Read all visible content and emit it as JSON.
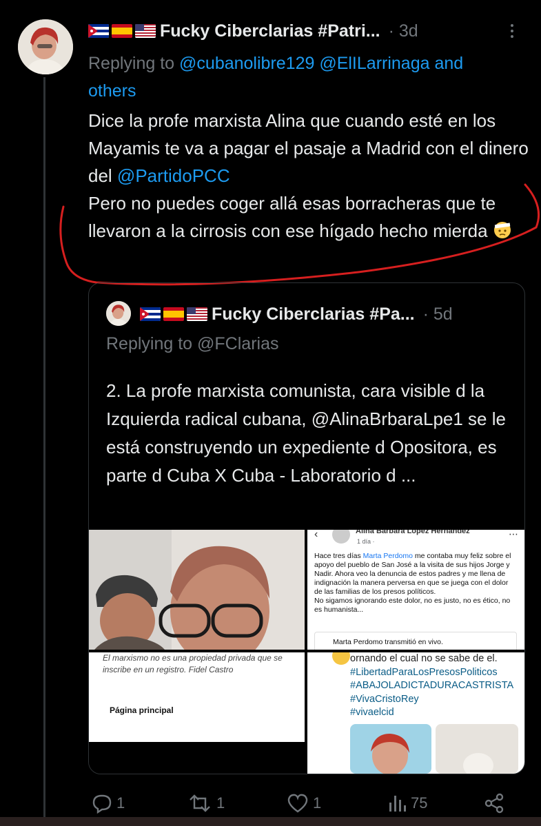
{
  "tweet": {
    "display_name": "Fucky Ciberclarias #Patri...",
    "time": "3d",
    "replying_prefix": "Replying to",
    "replying_mentions": "@cubanolibre129 @ElILarrinaga and",
    "replying_others": "others",
    "text_1": "Dice la profe marxista Alina que cuando esté en los Mayamis te va a pagar el pasaje a Madrid con el dinero del ",
    "text_mention": "@PartidoPCC",
    "text_2": "Pero no puedes coger allá esas borracheras que te llevaron a la cirrosis con ese hígado hecho mierda",
    "emoji": "face-with-bandage",
    "annotation_color": "#d61f1f"
  },
  "quoted": {
    "display_name": "Fucky Ciberclarias #Pa...",
    "time": "5d",
    "replying_prefix": "Replying to",
    "replying_mention": "@FClarias",
    "text": "2. La profe marxista comunista, cara visible d la Izquierda radical cubana, @AlinaBrbaraLpe1 se le está construyendo un expediente d Opositora, es parte d Cuba X Cuba - Laboratorio d ...",
    "media": {
      "fb_author": "Alina Barbara López Hernández",
      "fb_time": "1 día · ",
      "fb_post_1": "Hace tres días ",
      "fb_post_link": "Marta Perdomo",
      "fb_post_2": " me contaba muy feliz sobre el apoyo del pueblo de San José a la visita de sus hijos Jorge y Nadir. Ahora veo la denuncia de estos padres y me llena de indignación la manera perversa en que se juega con el dolor de las familias de los presos políticos.",
      "fb_post_3": "No sigamos ignorando este dolor, no es justo, no es ético, no es humanista...",
      "fb_live": "Marta Perdomo transmitió en vivo.",
      "quote_text": "El marxismo no es una propiedad privada que se inscribe en un registro. Fidel Castro",
      "home_label": "Página principal",
      "post_plain": "ornando el cual no se sabe de el.",
      "hashtags": [
        "#LibertadParaLosPresosPoliticos",
        "#ABAJOLADICTADURACASTRISTA",
        "#VivaCristoRey",
        "#vivaelcid"
      ]
    }
  },
  "actions": {
    "replies": "1",
    "reposts": "1",
    "likes": "1",
    "views": "75"
  },
  "colors": {
    "background": "#000000",
    "text": "#e7e9ea",
    "muted": "#71767b",
    "link": "#1d9bf0",
    "border": "#2f3336"
  }
}
